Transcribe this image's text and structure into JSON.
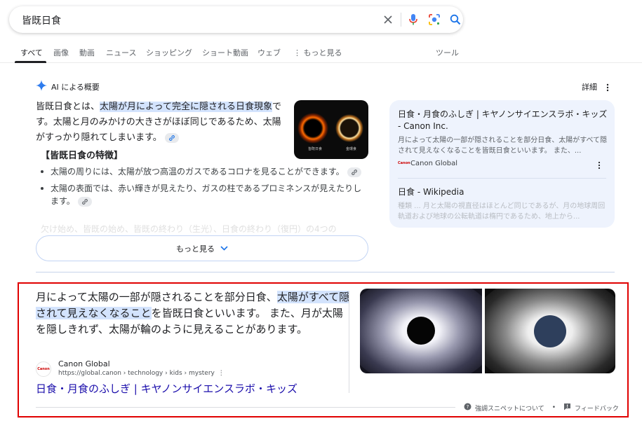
{
  "search": {
    "query": "皆既日食"
  },
  "tabs": [
    {
      "label": "すべて"
    },
    {
      "label": "画像"
    },
    {
      "label": "動画"
    },
    {
      "label": "ニュース"
    },
    {
      "label": "ショッピング"
    },
    {
      "label": "ショート動画"
    },
    {
      "label": "ウェブ"
    },
    {
      "label": "もっと見る"
    },
    {
      "label": "ツール"
    }
  ],
  "ai_overview": {
    "label": "AI による概要",
    "detail_label": "詳細",
    "intro_prefix": "皆既日食とは、",
    "intro_highlight": "太陽が月によって完全に隠される日食現象",
    "intro_suffix": "です。太陽と月のみかけの大きさがほぼ同じであるため、太陽がすっかり隠れてしまいます。",
    "section_title": "【皆既日食の特徴】",
    "bullets": [
      "太陽の周りには、太陽が放つ高温のガスであるコロナを見ることができます。",
      "太陽の表面では、赤い輝きが見えたり、ガスの柱であるプロミネンスが見えたりします。"
    ],
    "faded_line": "欠け始め、皆既の始め、皆既の終わり（生光）、日食の終わり（復円）の4つの",
    "more_button": "もっと見る",
    "thumbnail": {
      "label_left": "皆既日食",
      "label_right": "金環食"
    },
    "sources": [
      {
        "title": "日食・月食のふしぎ | キヤノンサイエンスラボ・キッズ - Canon Inc.",
        "snippet": "月によって太陽の一部が隠されることを部分日食、太陽がすべて隠されて見えなくなることを皆既日食といいます。 また、...",
        "site": "Canon Global",
        "logo_text": "Canon"
      },
      {
        "title": "日食 - Wikipedia",
        "snippet": "種類 ... 月と太陽の視直径はほとんど同じであるが、月の地球周回軌道および地球の公転軌道は楕円であるため、地上から..."
      }
    ]
  },
  "featured_snippet": {
    "text_prefix": "月によって太陽の一部が隠されることを部分日食、",
    "text_highlight": "太陽がすべて隠されて見えなくなること",
    "text_suffix": "を皆既日食といいます。 また、月が太陽を隠しきれず、太陽が輪のように見えることがあります。",
    "site_name": "Canon Global",
    "site_url": "https://global.canon › technology › kids › mystery",
    "logo_text": "Canon",
    "title": "日食・月食のふしぎ | キヤノンサイエンスラボ・キッズ",
    "about_label": "強調スニペットについて",
    "feedback_label": "フィードバック"
  },
  "colors": {
    "accent_blue": "#1a73e8",
    "link": "#1a0dab",
    "highlight": "#d3e3fd",
    "outline_red": "#e00000"
  }
}
